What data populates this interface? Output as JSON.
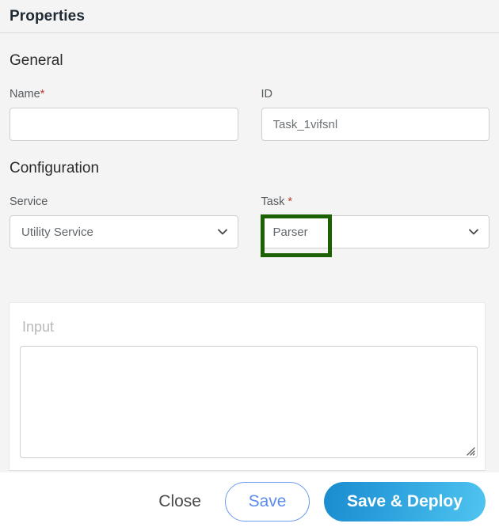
{
  "header": {
    "title": "Properties"
  },
  "general": {
    "section_title": "General",
    "name": {
      "label": "Name",
      "required_marker": "*",
      "value": "",
      "placeholder": ""
    },
    "id": {
      "label": "ID",
      "value": "Task_1vifsnl"
    }
  },
  "configuration": {
    "section_title": "Configuration",
    "service": {
      "label": "Service",
      "value": "Utility Service",
      "chevron_icon": "chevron-down-icon"
    },
    "task": {
      "label": "Task",
      "required_marker": "*",
      "value": "Parser",
      "chevron_icon": "chevron-down-icon",
      "highlight_color": "#1d6105"
    }
  },
  "input_panel": {
    "label": "Input",
    "value": "",
    "resize_handle_icon": "resize-grip-icon"
  },
  "footer": {
    "close_label": "Close",
    "save_label": "Save",
    "deploy_label": "Save & Deploy",
    "save_accent_color": "#5b8def",
    "deploy_gradient_start": "#1a8ccf",
    "deploy_gradient_end": "#50c5f0"
  }
}
